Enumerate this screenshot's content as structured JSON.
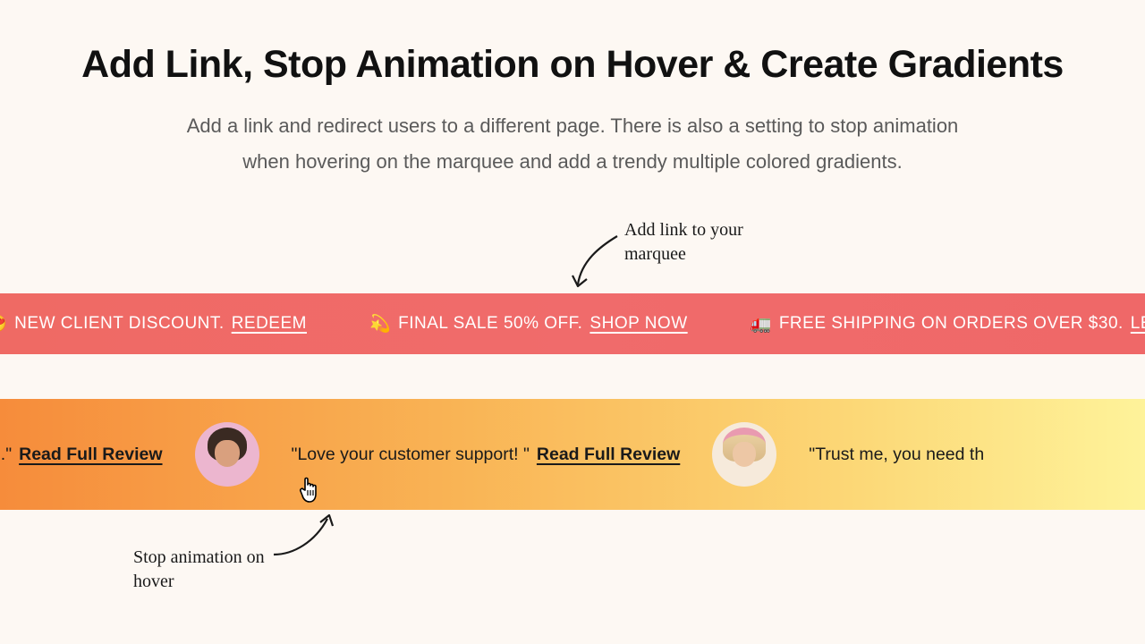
{
  "header": {
    "title": "Add Link, Stop Animation on Hover & Create Gradients",
    "subtitle": "Add a link and redirect users to a different page. There is also a setting to stop animation when hovering on the marquee and add a trendy multiple colored gradients."
  },
  "annotations": {
    "top": "Add link to your marquee",
    "bottom": "Stop animation on hover"
  },
  "marquee_red": {
    "items": [
      {
        "icon": "😍",
        "text": "NEW CLIENT DISCOUNT.",
        "link": "REDEEM"
      },
      {
        "icon": "💫",
        "text": "FINAL SALE 50% OFF.",
        "link": "SHOP NOW"
      },
      {
        "icon": "🚛",
        "text": "FREE SHIPPING ON ORDERS OVER $30.",
        "link": "LEARN MORE"
      }
    ]
  },
  "marquee_orange": {
    "reviews": [
      {
        "quote_fragment": "ral deodorant I've ever tried.\"",
        "link": "Read Full Review"
      },
      {
        "quote": "\"Love your customer support! \"",
        "link": "Read Full Review"
      },
      {
        "quote_fragment_right": "\"Trust me, you need th"
      }
    ]
  }
}
